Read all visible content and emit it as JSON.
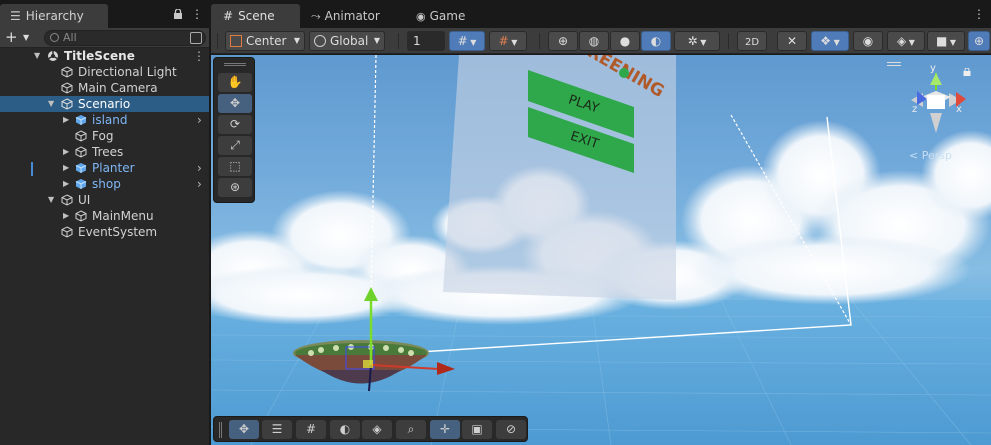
{
  "hierarchy": {
    "tab_label": "Hierarchy",
    "search_placeholder": "All",
    "add_label": "+",
    "items": [
      {
        "label": "TitleScene"
      },
      {
        "label": "Directional Light"
      },
      {
        "label": "Main Camera"
      },
      {
        "label": "Scenario"
      },
      {
        "label": "island"
      },
      {
        "label": "Fog"
      },
      {
        "label": "Trees"
      },
      {
        "label": "Planter"
      },
      {
        "label": "shop"
      },
      {
        "label": "UI"
      },
      {
        "label": "MainMenu"
      },
      {
        "label": "EventSystem"
      }
    ]
  },
  "tabs": {
    "scene": "Scene",
    "animator": "Animator",
    "game": "Game"
  },
  "scene_toolbar": {
    "pivot_mode": "Center",
    "pivot_rotation": "Global",
    "grid_snap_value": "1"
  },
  "viewport": {
    "menu_play": "PLAY",
    "menu_exit": "EXIT",
    "camera_mode": "< Persp",
    "axis_y": "y",
    "axis_z": "z",
    "axis_x": "x",
    "sky_color": "#6aa7db",
    "button_color": "#2ea84a"
  },
  "icons": [
    "list-icon",
    "lock-icon",
    "more-icon",
    "hash-icon",
    "animator-icon",
    "gamepad-icon",
    "hand-icon",
    "move-icon",
    "rotate-icon",
    "scale-icon",
    "rect-icon",
    "transform-icon"
  ]
}
